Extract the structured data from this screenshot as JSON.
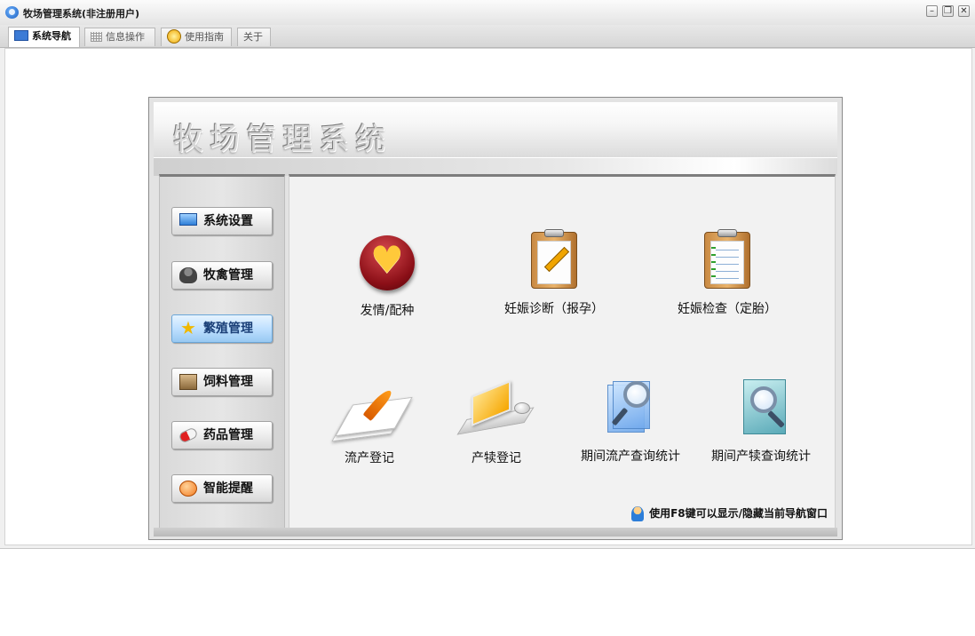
{
  "window": {
    "title": "牧场管理系统(非注册用户)",
    "controls": {
      "minimize": "–",
      "restore": "❐",
      "close": "✕"
    }
  },
  "tabs": [
    {
      "label": "系统导航",
      "active": true,
      "icon": "monitor-icon"
    },
    {
      "label": "信息操作",
      "active": false,
      "icon": "grid-icon"
    },
    {
      "label": "使用指南",
      "active": false,
      "icon": "guide-icon"
    },
    {
      "label": "关于",
      "active": false
    }
  ],
  "panel": {
    "title": "牧场管理系统"
  },
  "sidebar": {
    "items": [
      {
        "label": "系统设置",
        "icon": "monitor-icon",
        "active": false
      },
      {
        "label": "牧禽管理",
        "icon": "person-icon",
        "active": false
      },
      {
        "label": "繁殖管理",
        "icon": "star-icon",
        "active": true
      },
      {
        "label": "饲料管理",
        "icon": "box-icon",
        "active": false
      },
      {
        "label": "药品管理",
        "icon": "pill-icon",
        "active": false
      },
      {
        "label": "智能提醒",
        "icon": "alarm-icon",
        "active": false
      }
    ]
  },
  "functions": [
    {
      "label": "发情/配种",
      "icon": "heart-icon"
    },
    {
      "label": "妊娠诊断（报孕）",
      "icon": "clipboard-pencil-icon"
    },
    {
      "label": "妊娠检查（定胎）",
      "icon": "clipboard-checklist-icon"
    },
    {
      "label": "流产登记",
      "icon": "paper-quill-icon"
    },
    {
      "label": "产犊登记",
      "icon": "laptop-icon"
    },
    {
      "label": "期间流产查询统计",
      "icon": "magnifier-docs-icon"
    },
    {
      "label": "期间产犊查询统计",
      "icon": "magnifier-doc-icon"
    }
  ],
  "hint": {
    "text": "使用F8键可以显示/隐藏当前导航窗口",
    "icon": "user-tip-icon"
  },
  "colors": {
    "accent_active": "#98c9f2",
    "title_bar": "#e4e4e4",
    "heart": "#8b0f17"
  }
}
